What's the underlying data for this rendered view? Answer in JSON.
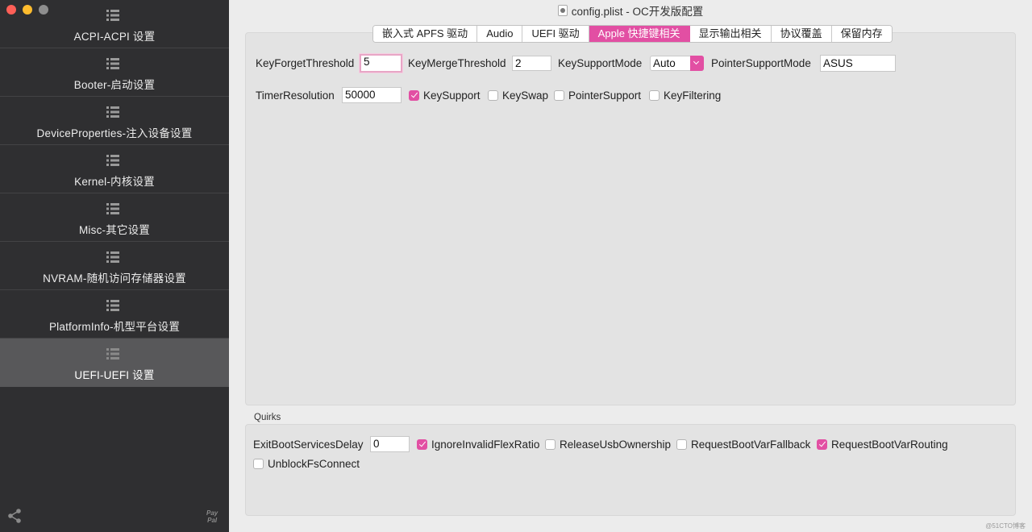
{
  "window": {
    "title": "config.plist - OC开发版配置"
  },
  "sidebar": {
    "items": [
      {
        "label": "ACPI-ACPI 设置"
      },
      {
        "label": "Booter-启动设置"
      },
      {
        "label": "DeviceProperties-注入设备设置"
      },
      {
        "label": "Kernel-内核设置"
      },
      {
        "label": "Misc-其它设置"
      },
      {
        "label": "NVRAM-随机访问存储器设置"
      },
      {
        "label": "PlatformInfo-机型平台设置"
      },
      {
        "label": "UEFI-UEFI 设置",
        "active": true
      }
    ],
    "footer": {
      "paypal_line1": "Pay",
      "paypal_line2": "Pal"
    }
  },
  "tabs": [
    {
      "label": "嵌入式 APFS 驱动"
    },
    {
      "label": "Audio"
    },
    {
      "label": "UEFI 驱动"
    },
    {
      "label": "Apple 快捷键相关",
      "active": true
    },
    {
      "label": "显示输出相关"
    },
    {
      "label": "协议覆盖"
    },
    {
      "label": "保留内存"
    }
  ],
  "fields": {
    "key_forget_threshold": {
      "label": "KeyForgetThreshold",
      "value": "5"
    },
    "key_merge_threshold": {
      "label": "KeyMergeThreshold",
      "value": "2"
    },
    "key_support_mode": {
      "label": "KeySupportMode",
      "value": "Auto"
    },
    "pointer_support_mode": {
      "label": "PointerSupportMode",
      "value": "ASUS"
    },
    "timer_resolution": {
      "label": "TimerResolution",
      "value": "50000"
    }
  },
  "checkboxes": {
    "key_support": {
      "label": "KeySupport",
      "checked": true
    },
    "key_swap": {
      "label": "KeySwap",
      "checked": false
    },
    "pointer_support": {
      "label": "PointerSupport",
      "checked": false
    },
    "key_filtering": {
      "label": "KeyFiltering",
      "checked": false
    }
  },
  "quirks": {
    "title": "Quirks",
    "exit_boot_services_delay": {
      "label": "ExitBootServicesDelay",
      "value": "0"
    },
    "ignore_invalid_flex_ratio": {
      "label": "IgnoreInvalidFlexRatio",
      "checked": true
    },
    "release_usb_ownership": {
      "label": "ReleaseUsbOwnership",
      "checked": false
    },
    "request_boot_var_fallback": {
      "label": "RequestBootVarFallback",
      "checked": false
    },
    "request_boot_var_routing": {
      "label": "RequestBootVarRouting",
      "checked": true
    },
    "unblock_fs_connect": {
      "label": "UnblockFsConnect",
      "checked": false
    }
  },
  "watermark": "@51CTO博客",
  "colors": {
    "accent": "#e24fa3",
    "sidebar_bg": "#2f2f31",
    "sidebar_active": "#58585a"
  }
}
